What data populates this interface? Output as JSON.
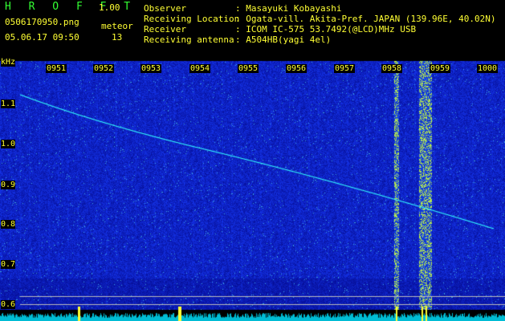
{
  "header": {
    "app_title": "H R O F F T",
    "version": "1.00",
    "filename": "0506170950.png",
    "datetime": "05.06.17 09:50",
    "meteor_label": "meteor",
    "meteor_count": "13"
  },
  "info": [
    {
      "label": "Observer",
      "value": ": Masayuki Kobayashi"
    },
    {
      "label": "Receiving Location",
      "value": ": Ogata-vill. Akita-Pref. JAPAN (139.96E, 40.02N)"
    },
    {
      "label": "Receiver",
      "value": ": ICOM IC-575 53.7492(@LCD)MHz USB"
    },
    {
      "label": "Receiving antenna",
      "value": ": A504HB(yagi 4el)"
    }
  ],
  "axis": {
    "freq_unit": "kHz",
    "time_labels": [
      "0951",
      "0952",
      "0953",
      "0954",
      "0955",
      "0956",
      "0957",
      "0958",
      "0959",
      "1000"
    ],
    "freq_labels": [
      "1.1",
      "1.0",
      "0.9",
      "0.8",
      "0.7",
      "0.6"
    ]
  },
  "colors": {
    "label_yellow": "#ffff33",
    "title_green": "#33ff33",
    "background": "#000000",
    "spectrum_blue": "#1a3aa8",
    "trace_cyan": "#33ffff"
  }
}
